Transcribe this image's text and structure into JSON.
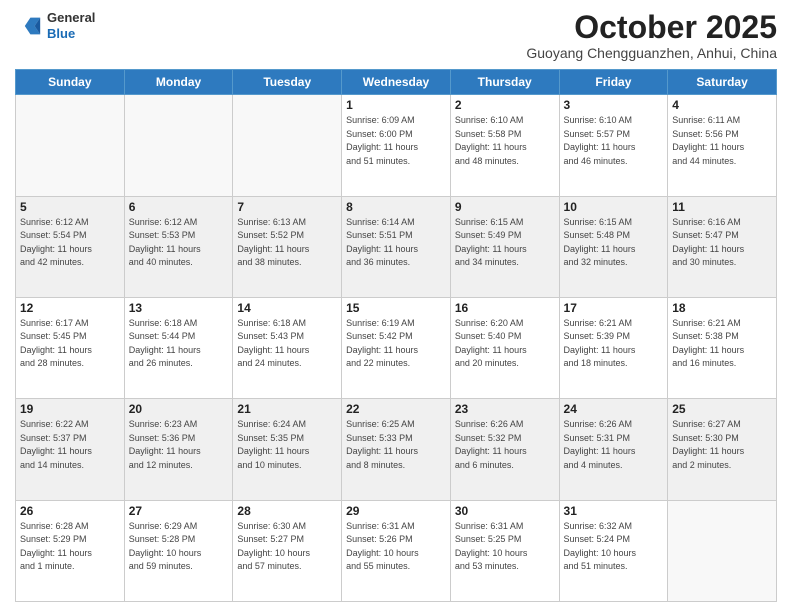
{
  "header": {
    "logo_general": "General",
    "logo_blue": "Blue",
    "month": "October 2025",
    "location": "Guoyang Chengguanzhen, Anhui, China"
  },
  "days_of_week": [
    "Sunday",
    "Monday",
    "Tuesday",
    "Wednesday",
    "Thursday",
    "Friday",
    "Saturday"
  ],
  "weeks": [
    [
      {
        "day": "",
        "info": ""
      },
      {
        "day": "",
        "info": ""
      },
      {
        "day": "",
        "info": ""
      },
      {
        "day": "1",
        "info": "Sunrise: 6:09 AM\nSunset: 6:00 PM\nDaylight: 11 hours\nand 51 minutes."
      },
      {
        "day": "2",
        "info": "Sunrise: 6:10 AM\nSunset: 5:58 PM\nDaylight: 11 hours\nand 48 minutes."
      },
      {
        "day": "3",
        "info": "Sunrise: 6:10 AM\nSunset: 5:57 PM\nDaylight: 11 hours\nand 46 minutes."
      },
      {
        "day": "4",
        "info": "Sunrise: 6:11 AM\nSunset: 5:56 PM\nDaylight: 11 hours\nand 44 minutes."
      }
    ],
    [
      {
        "day": "5",
        "info": "Sunrise: 6:12 AM\nSunset: 5:54 PM\nDaylight: 11 hours\nand 42 minutes."
      },
      {
        "day": "6",
        "info": "Sunrise: 6:12 AM\nSunset: 5:53 PM\nDaylight: 11 hours\nand 40 minutes."
      },
      {
        "day": "7",
        "info": "Sunrise: 6:13 AM\nSunset: 5:52 PM\nDaylight: 11 hours\nand 38 minutes."
      },
      {
        "day": "8",
        "info": "Sunrise: 6:14 AM\nSunset: 5:51 PM\nDaylight: 11 hours\nand 36 minutes."
      },
      {
        "day": "9",
        "info": "Sunrise: 6:15 AM\nSunset: 5:49 PM\nDaylight: 11 hours\nand 34 minutes."
      },
      {
        "day": "10",
        "info": "Sunrise: 6:15 AM\nSunset: 5:48 PM\nDaylight: 11 hours\nand 32 minutes."
      },
      {
        "day": "11",
        "info": "Sunrise: 6:16 AM\nSunset: 5:47 PM\nDaylight: 11 hours\nand 30 minutes."
      }
    ],
    [
      {
        "day": "12",
        "info": "Sunrise: 6:17 AM\nSunset: 5:45 PM\nDaylight: 11 hours\nand 28 minutes."
      },
      {
        "day": "13",
        "info": "Sunrise: 6:18 AM\nSunset: 5:44 PM\nDaylight: 11 hours\nand 26 minutes."
      },
      {
        "day": "14",
        "info": "Sunrise: 6:18 AM\nSunset: 5:43 PM\nDaylight: 11 hours\nand 24 minutes."
      },
      {
        "day": "15",
        "info": "Sunrise: 6:19 AM\nSunset: 5:42 PM\nDaylight: 11 hours\nand 22 minutes."
      },
      {
        "day": "16",
        "info": "Sunrise: 6:20 AM\nSunset: 5:40 PM\nDaylight: 11 hours\nand 20 minutes."
      },
      {
        "day": "17",
        "info": "Sunrise: 6:21 AM\nSunset: 5:39 PM\nDaylight: 11 hours\nand 18 minutes."
      },
      {
        "day": "18",
        "info": "Sunrise: 6:21 AM\nSunset: 5:38 PM\nDaylight: 11 hours\nand 16 minutes."
      }
    ],
    [
      {
        "day": "19",
        "info": "Sunrise: 6:22 AM\nSunset: 5:37 PM\nDaylight: 11 hours\nand 14 minutes."
      },
      {
        "day": "20",
        "info": "Sunrise: 6:23 AM\nSunset: 5:36 PM\nDaylight: 11 hours\nand 12 minutes."
      },
      {
        "day": "21",
        "info": "Sunrise: 6:24 AM\nSunset: 5:35 PM\nDaylight: 11 hours\nand 10 minutes."
      },
      {
        "day": "22",
        "info": "Sunrise: 6:25 AM\nSunset: 5:33 PM\nDaylight: 11 hours\nand 8 minutes."
      },
      {
        "day": "23",
        "info": "Sunrise: 6:26 AM\nSunset: 5:32 PM\nDaylight: 11 hours\nand 6 minutes."
      },
      {
        "day": "24",
        "info": "Sunrise: 6:26 AM\nSunset: 5:31 PM\nDaylight: 11 hours\nand 4 minutes."
      },
      {
        "day": "25",
        "info": "Sunrise: 6:27 AM\nSunset: 5:30 PM\nDaylight: 11 hours\nand 2 minutes."
      }
    ],
    [
      {
        "day": "26",
        "info": "Sunrise: 6:28 AM\nSunset: 5:29 PM\nDaylight: 11 hours\nand 1 minute."
      },
      {
        "day": "27",
        "info": "Sunrise: 6:29 AM\nSunset: 5:28 PM\nDaylight: 10 hours\nand 59 minutes."
      },
      {
        "day": "28",
        "info": "Sunrise: 6:30 AM\nSunset: 5:27 PM\nDaylight: 10 hours\nand 57 minutes."
      },
      {
        "day": "29",
        "info": "Sunrise: 6:31 AM\nSunset: 5:26 PM\nDaylight: 10 hours\nand 55 minutes."
      },
      {
        "day": "30",
        "info": "Sunrise: 6:31 AM\nSunset: 5:25 PM\nDaylight: 10 hours\nand 53 minutes."
      },
      {
        "day": "31",
        "info": "Sunrise: 6:32 AM\nSunset: 5:24 PM\nDaylight: 10 hours\nand 51 minutes."
      },
      {
        "day": "",
        "info": ""
      }
    ]
  ]
}
